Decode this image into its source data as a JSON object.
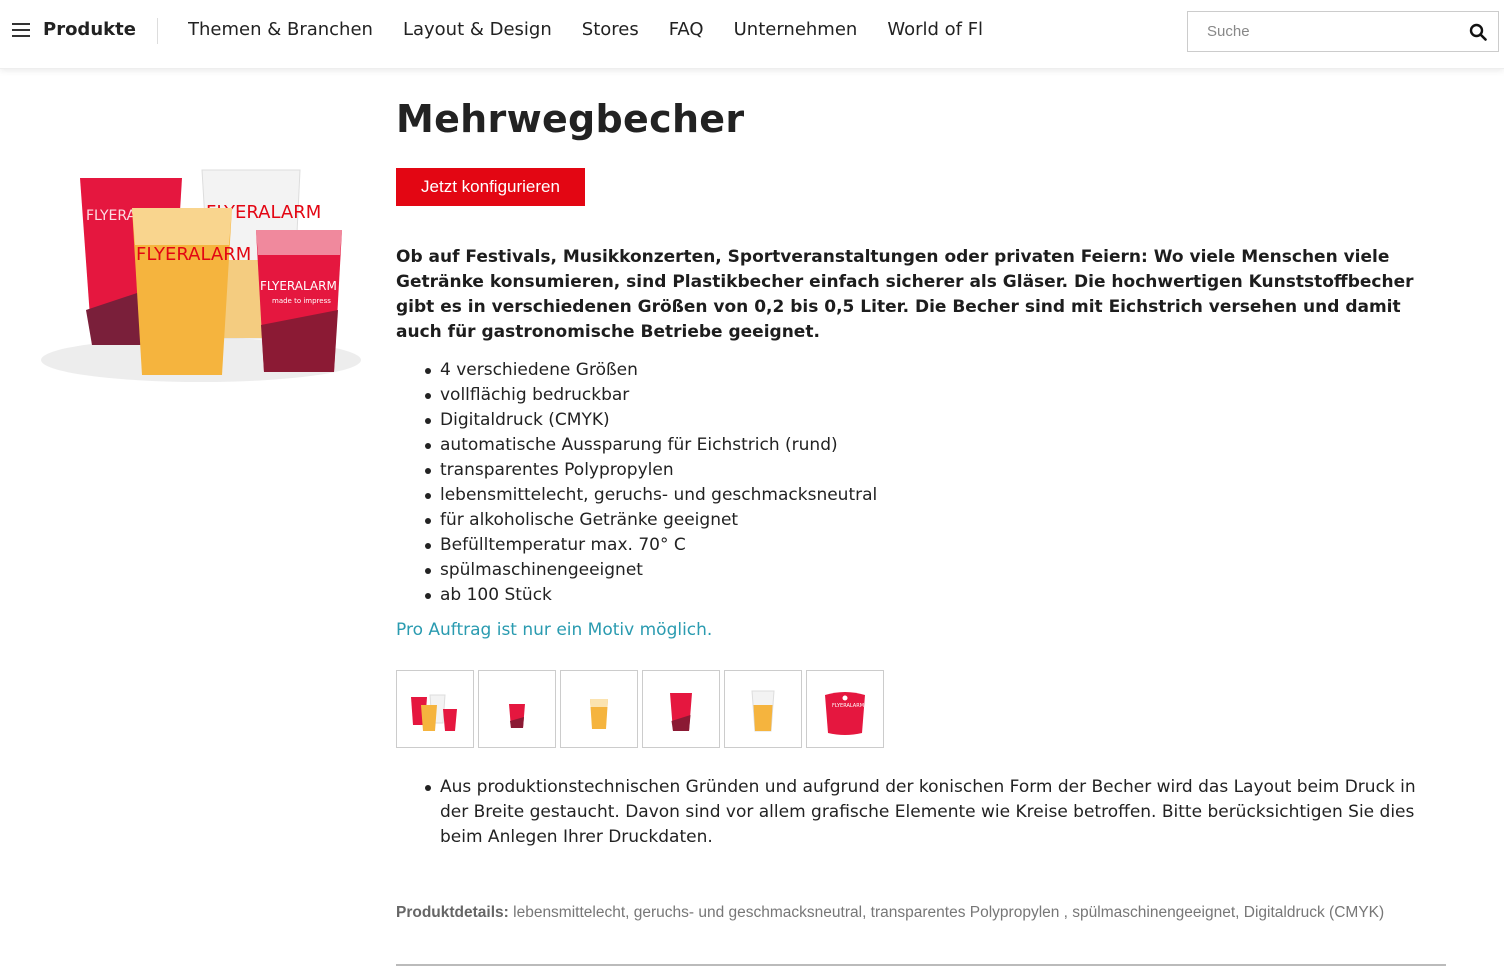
{
  "header": {
    "menu_label": "Produkte",
    "nav": [
      "Themen & Branchen",
      "Layout & Design",
      "Stores",
      "FAQ",
      "Unternehmen",
      "World of Fl"
    ],
    "search_placeholder": "Suche"
  },
  "product": {
    "title": "Mehrwegbecher",
    "cta": "Jetzt konfigurieren",
    "intro": "Ob auf Festivals, Musikkonzerten, Sportveranstaltungen oder privaten Feiern: Wo viele Menschen viele Getränke konsumieren, sind Plastikbecher einfach sicherer als Gläser. Die hochwertigen Kunststoffbecher gibt es in verschiedenen Größen von 0,2 bis 0,5 Liter. Die Becher sind mit Eichstrich versehen und damit auch für gastronomische Betriebe geeignet.",
    "features": [
      "4 verschiedene Größen",
      "vollflächig bedruckbar",
      "Digitaldruck (CMYK)",
      "automatische Aussparung für Eichstrich (rund)",
      "transparentes Polypropylen",
      "lebensmittelecht, geruchs- und geschmacksneutral",
      "für alkoholische Getränke geeignet",
      "Befülltemperatur max. 70° C",
      "spülmaschinengeeignet",
      "ab 100 Stück"
    ],
    "note": "Pro Auftrag ist nur ein Motiv möglich.",
    "hint": "Aus produktionstechnischen Gründen und aufgrund der konischen Form der Becher wird das Layout beim Druck in der Breite gestaucht. Davon sind vor allem grafische Elemente wie Kreise betroffen. Bitte berücksichtigen Sie dies beim Anlegen Ihrer Druckdaten.",
    "details_label": "Produktdetails:",
    "details_text": " lebensmittelecht, geruchs- und geschmacksneutral, transparentes Polypropylen , spülmaschinengeeignet, Digitaldruck (CMYK)"
  },
  "image_text": {
    "brand": "FLYERALARM",
    "tagline": "made to impress"
  },
  "colors": {
    "brand_red": "#e30613",
    "link_teal": "#2a9bb0"
  }
}
